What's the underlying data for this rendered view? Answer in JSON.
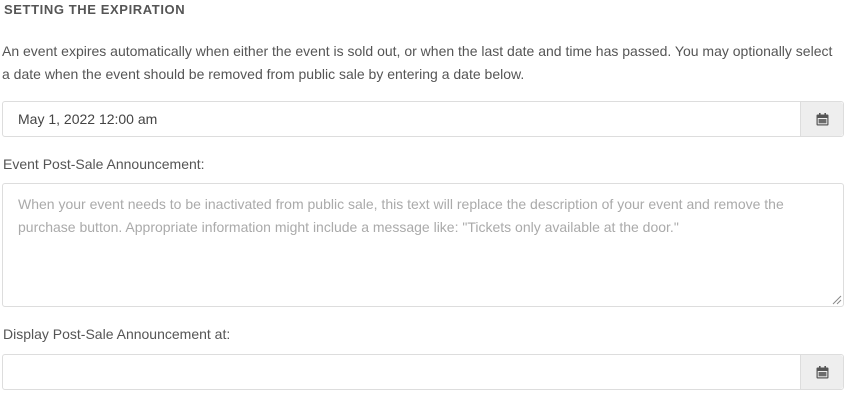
{
  "section": {
    "heading": "SETTING THE EXPIRATION",
    "description": "An event expires automatically when either the event is sold out, or when the last date and time has passed. You may optionally select a date when the event should be removed from public sale by entering a date below."
  },
  "expiration": {
    "value": "May 1, 2022 12:00 am",
    "icon": "calendar-icon"
  },
  "post_sale": {
    "label": "Event Post-Sale Announcement:",
    "placeholder": "When your event needs to be inactivated from public sale, this text will replace the description of your event and remove the purchase button. Appropriate information might include a message like: \"Tickets only available at the door.\""
  },
  "display_at": {
    "label": "Display Post-Sale Announcement at:",
    "value": "",
    "icon": "calendar-icon"
  }
}
